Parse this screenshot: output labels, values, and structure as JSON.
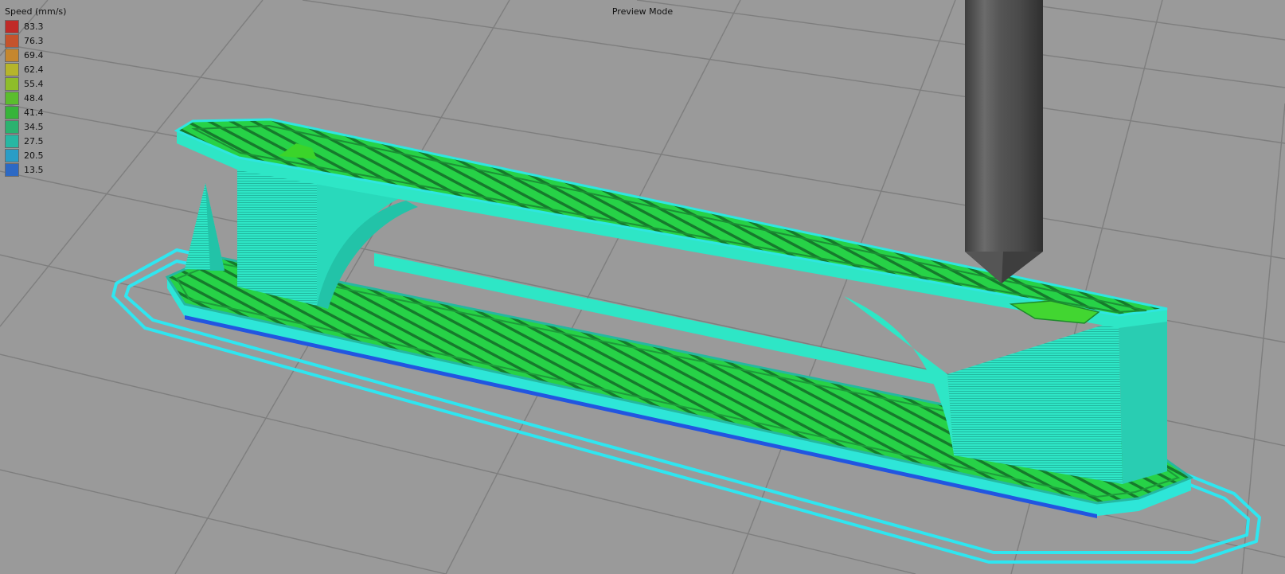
{
  "header": {
    "mode_label": "Preview Mode"
  },
  "legend": {
    "title": "Speed (mm/s)",
    "items": [
      {
        "label": "83.3",
        "color": "#c02a27"
      },
      {
        "label": "76.3",
        "color": "#c5532c"
      },
      {
        "label": "69.4",
        "color": "#c5872e"
      },
      {
        "label": "62.4",
        "color": "#b6b52a"
      },
      {
        "label": "55.4",
        "color": "#8ebd2a"
      },
      {
        "label": "48.4",
        "color": "#5bbd2d"
      },
      {
        "label": "41.4",
        "color": "#37b43a"
      },
      {
        "label": "34.5",
        "color": "#2bb26f"
      },
      {
        "label": "27.5",
        "color": "#27b7a3"
      },
      {
        "label": "20.5",
        "color": "#2a9dc6"
      },
      {
        "label": "13.5",
        "color": "#2d69c4"
      }
    ]
  },
  "scene": {
    "colors": {
      "background": "#9a9a9a",
      "grid_line": "#808080",
      "skirt": "#2fe6f0",
      "wall": "#2de8c8",
      "infill": "#27d247",
      "infill_dark": "#1a8a33",
      "first_layer": "#2255e0",
      "nozzle": "#4e4e4e"
    }
  }
}
